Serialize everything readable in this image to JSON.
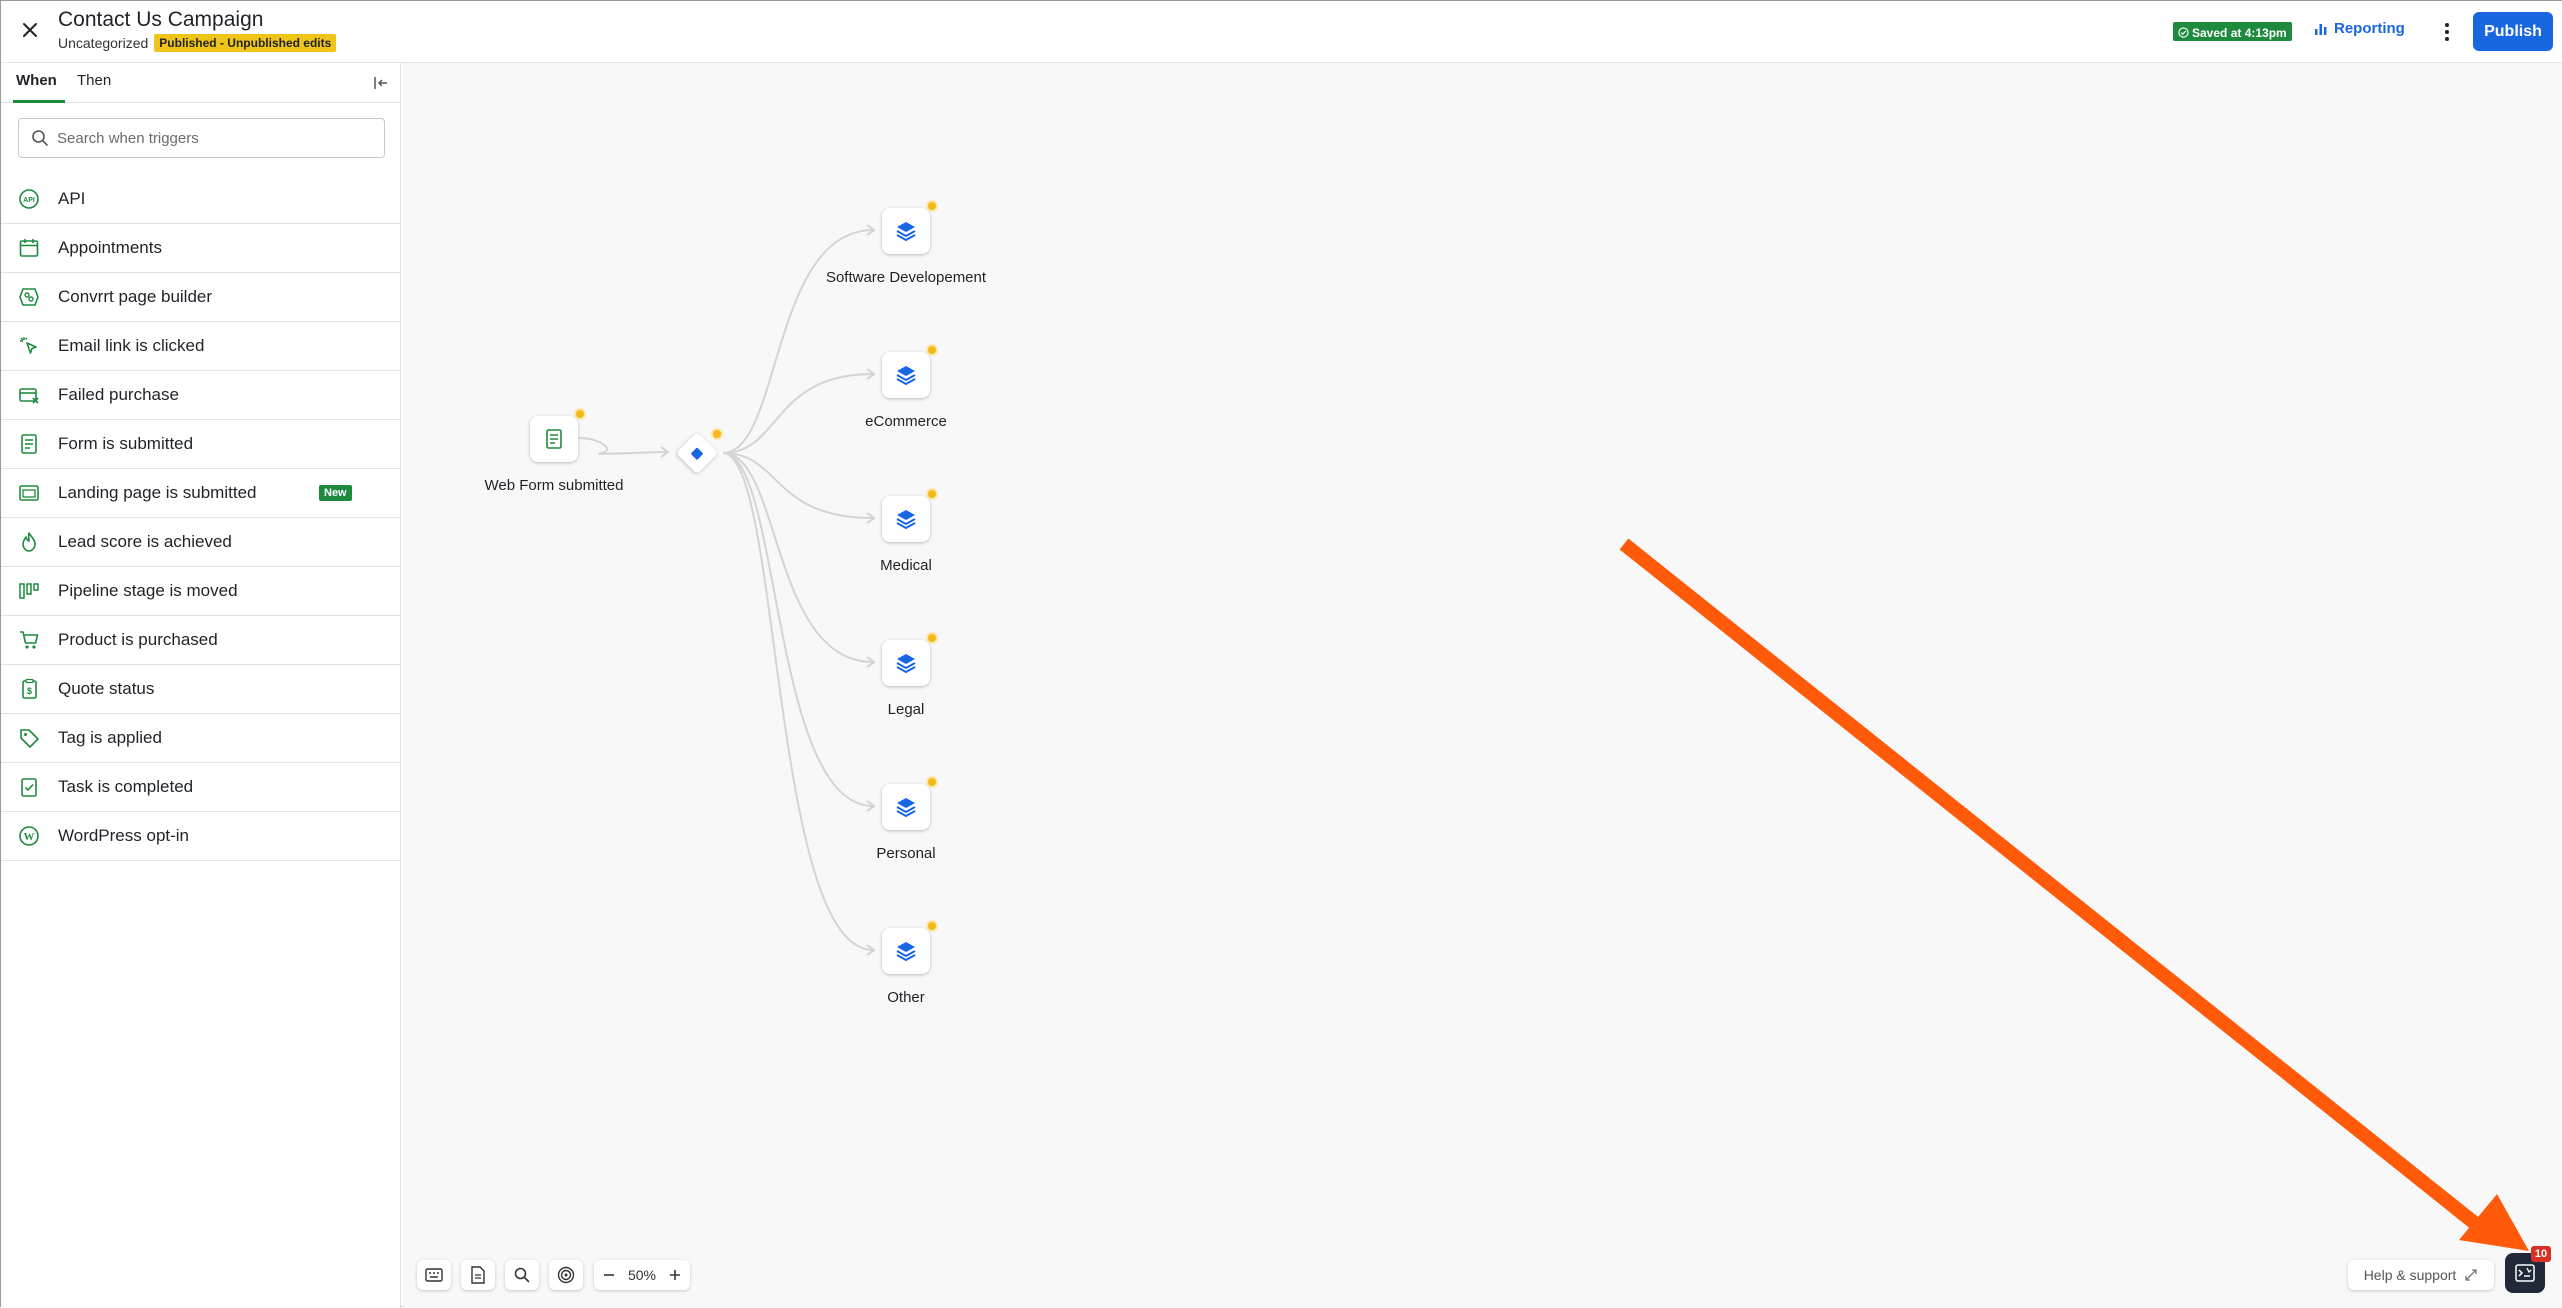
{
  "header": {
    "title": "Contact Us Campaign",
    "category": "Uncategorized",
    "status": "Published - Unpublished edits",
    "saved": "Saved at 4:13pm",
    "reporting_label": "Reporting",
    "publish_label": "Publish"
  },
  "sidebar": {
    "tabs": [
      {
        "label": "When",
        "active": true
      },
      {
        "label": "Then",
        "active": false
      }
    ],
    "search_placeholder": "Search when triggers",
    "triggers": [
      {
        "label": "API",
        "icon": "api-icon"
      },
      {
        "label": "Appointments",
        "icon": "calendar-icon"
      },
      {
        "label": "Convrrt page builder",
        "icon": "page-builder-icon"
      },
      {
        "label": "Email link is clicked",
        "icon": "cursor-click-icon"
      },
      {
        "label": "Failed purchase",
        "icon": "card-x-icon"
      },
      {
        "label": "Form is submitted",
        "icon": "form-icon"
      },
      {
        "label": "Landing page is submitted",
        "icon": "landing-page-icon",
        "badge": "New"
      },
      {
        "label": "Lead score is achieved",
        "icon": "flame-icon"
      },
      {
        "label": "Pipeline stage is moved",
        "icon": "pipeline-icon"
      },
      {
        "label": "Product is purchased",
        "icon": "cart-icon"
      },
      {
        "label": "Quote status",
        "icon": "quote-icon"
      },
      {
        "label": "Tag is applied",
        "icon": "tag-icon"
      },
      {
        "label": "Task is completed",
        "icon": "task-icon"
      },
      {
        "label": "WordPress opt-in",
        "icon": "wordpress-icon"
      }
    ]
  },
  "canvas": {
    "trigger_node": {
      "label": "Web Form submitted",
      "icon": "form-icon"
    },
    "split_node": {
      "icon": "diamond-icon"
    },
    "branches": [
      {
        "label": "Software Developement",
        "icon": "layers-icon"
      },
      {
        "label": "eCommerce",
        "icon": "layers-icon"
      },
      {
        "label": "Medical",
        "icon": "layers-icon"
      },
      {
        "label": "Legal",
        "icon": "layers-icon"
      },
      {
        "label": "Personal",
        "icon": "layers-icon"
      },
      {
        "label": "Other",
        "icon": "layers-icon"
      }
    ]
  },
  "toolbar": {
    "zoom": "50%",
    "help_label": "Help & support",
    "console_count": "10"
  },
  "colors": {
    "accent": "#1866e0",
    "success": "#1e8a3e",
    "warning": "#f0c419",
    "annotation_arrow": "#ff5a0a"
  }
}
